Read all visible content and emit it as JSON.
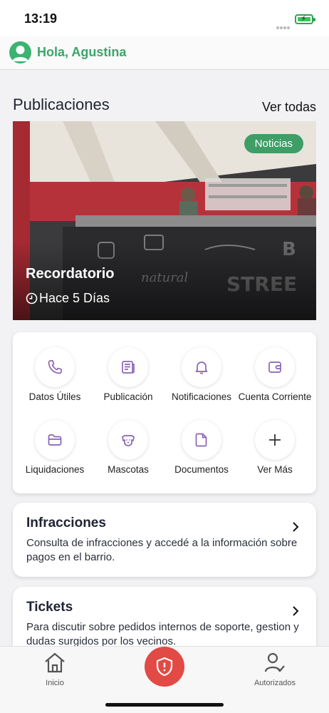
{
  "status": {
    "time": "13:19"
  },
  "header": {
    "greeting": "Hola, Agustina"
  },
  "publications": {
    "title": "Publicaciones",
    "see_all": "Ver todas",
    "card": {
      "tag": "Noticias",
      "title": "Recordatorio",
      "time": "Hace 5 Días"
    }
  },
  "shortcuts": [
    {
      "label": "Datos Útiles",
      "icon": "phone-icon"
    },
    {
      "label": "Publicación",
      "icon": "newspaper-icon"
    },
    {
      "label": "Notificaciones",
      "icon": "bell-icon"
    },
    {
      "label": "Cuenta Corriente",
      "icon": "wallet-icon"
    },
    {
      "label": "Liquidaciones",
      "icon": "folder-icon"
    },
    {
      "label": "Mascotas",
      "icon": "dog-icon"
    },
    {
      "label": "Documentos",
      "icon": "document-icon"
    },
    {
      "label": "Ver Más",
      "icon": "plus-icon"
    }
  ],
  "cards": [
    {
      "title": "Infracciones",
      "description": "Consulta de infracciones y accedé a la información sobre pagos en el barrio."
    },
    {
      "title": "Tickets",
      "description": "Para discutir sobre pedidos internos de soporte, gestion y dudas surgidos por los vecinos."
    }
  ],
  "tabbar": {
    "home": "Inicio",
    "authorized": "Autorizados"
  },
  "colors": {
    "accent_purple": "#8a63b5",
    "green": "#3e9e66",
    "sos_red": "#e24a45"
  }
}
